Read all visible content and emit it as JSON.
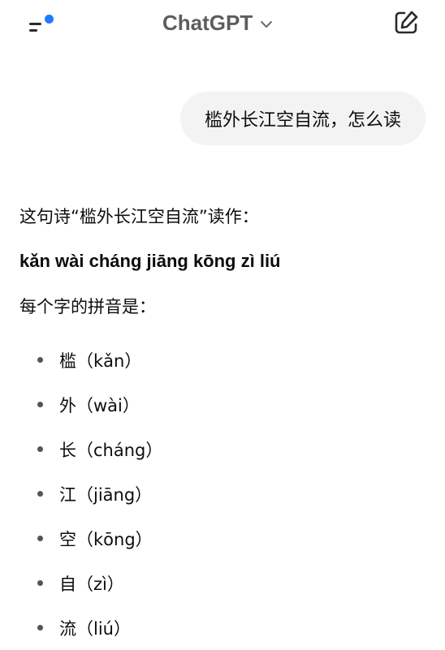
{
  "header": {
    "title": "ChatGPT",
    "icons": {
      "menu": "menu-icon",
      "notification": "notification-dot",
      "chevron": "chevron-down-icon",
      "compose": "compose-icon"
    },
    "accent_color": "#1f7bff"
  },
  "conversation": {
    "user_message": "槛外长江空自流，怎么读",
    "assistant": {
      "intro": "这句诗“槛外长江空自流”读作：",
      "full_pinyin": "kǎn wài cháng jiāng kōng zì liú",
      "list_intro": "每个字的拼音是：",
      "items": [
        {
          "text": "槛（kǎn）"
        },
        {
          "text": "外（wài）"
        },
        {
          "text": "长（cháng）"
        },
        {
          "text": "江（jiāng）"
        },
        {
          "text": "空（kōng）"
        },
        {
          "text": "自（zì）"
        },
        {
          "text": "流（liú）"
        }
      ]
    }
  }
}
